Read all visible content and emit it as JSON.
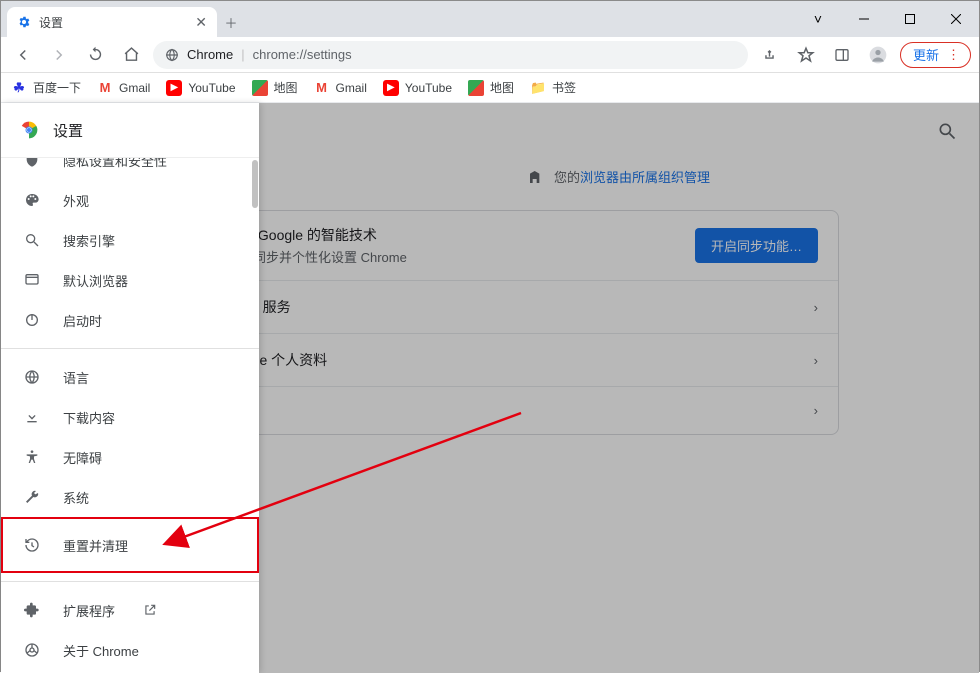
{
  "window": {
    "tab_title": "设置",
    "dropdown_glyph": "˅"
  },
  "toolbar": {
    "site_label": "Chrome",
    "url": "chrome://settings",
    "update_label": "更新"
  },
  "bookmarks": [
    {
      "label": "百度一下",
      "icon": "baidu"
    },
    {
      "label": "Gmail",
      "icon": "gmail"
    },
    {
      "label": "YouTube",
      "icon": "yt"
    },
    {
      "label": "地图",
      "icon": "maps"
    },
    {
      "label": "Gmail",
      "icon": "gmail"
    },
    {
      "label": "YouTube",
      "icon": "yt"
    },
    {
      "label": "地图",
      "icon": "maps"
    },
    {
      "label": "书签",
      "icon": "folder"
    }
  ],
  "sidebar": {
    "title": "设置",
    "items": [
      {
        "label": "隐私设置和安全性",
        "icon": "shield"
      },
      {
        "label": "外观",
        "icon": "palette"
      },
      {
        "label": "搜索引擎",
        "icon": "search"
      },
      {
        "label": "默认浏览器",
        "icon": "browser"
      },
      {
        "label": "启动时",
        "icon": "power"
      }
    ],
    "items2": [
      {
        "label": "语言",
        "icon": "globe"
      },
      {
        "label": "下载内容",
        "icon": "download"
      },
      {
        "label": "无障碍",
        "icon": "accessibility"
      },
      {
        "label": "系统",
        "icon": "wrench"
      },
      {
        "label": "重置并清理",
        "icon": "restore"
      }
    ],
    "items3": [
      {
        "label": "扩展程序",
        "icon": "extension",
        "external": true
      },
      {
        "label": "关于 Chrome",
        "icon": "chrome"
      }
    ]
  },
  "main": {
    "org_prefix": "您的",
    "org_link": "浏览器由所属组织管理",
    "sync_title_suffix": "享 Google 的智能技术",
    "sync_sub_suffix": "上同步并个性化设置 Chrome",
    "sync_button": "开启同步功能…",
    "row1_suffix": "gle 服务",
    "row2_suffix": "ome 个人资料"
  }
}
